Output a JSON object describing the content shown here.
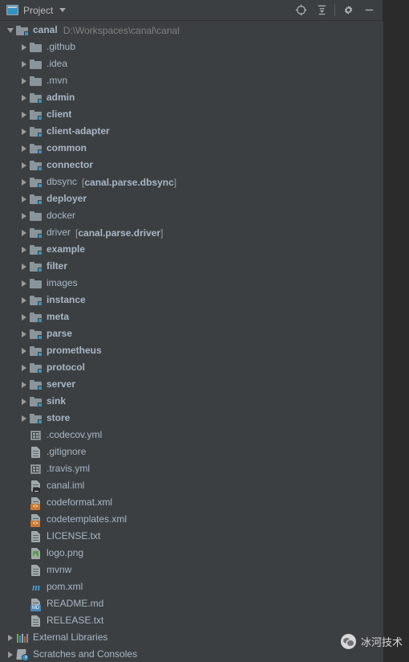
{
  "header": {
    "title": "Project",
    "icon": "project-window-icon",
    "dropdown_icon": "chevron-down-icon",
    "buttons": [
      {
        "name": "select-opened-file-button",
        "icon": "crosshair-target-icon",
        "label": ""
      },
      {
        "name": "collapse-all-button",
        "icon": "collapse-all-icon",
        "label": ""
      },
      {
        "name": "settings-button",
        "icon": "gear-icon",
        "label": ""
      },
      {
        "name": "hide-button",
        "icon": "minimize-dash-icon",
        "label": ""
      }
    ]
  },
  "tree": {
    "root": {
      "label": "canal",
      "path": "D:\\Workspaces\\canal\\canal",
      "icon": "module-folder-icon",
      "expanded": true
    },
    "items": [
      {
        "label": ".github",
        "icon": "folder-icon",
        "kind": "folder",
        "indent": 1,
        "expandable": true,
        "bold": false,
        "module": ""
      },
      {
        "label": ".idea",
        "icon": "folder-icon",
        "kind": "folder",
        "indent": 1,
        "expandable": true,
        "bold": false,
        "module": ""
      },
      {
        "label": ".mvn",
        "icon": "folder-icon",
        "kind": "folder",
        "indent": 1,
        "expandable": true,
        "bold": false,
        "module": ""
      },
      {
        "label": "admin",
        "icon": "module-folder-icon",
        "kind": "module",
        "indent": 1,
        "expandable": true,
        "bold": true,
        "module": ""
      },
      {
        "label": "client",
        "icon": "module-folder-icon",
        "kind": "module",
        "indent": 1,
        "expandable": true,
        "bold": true,
        "module": ""
      },
      {
        "label": "client-adapter",
        "icon": "module-folder-icon",
        "kind": "module",
        "indent": 1,
        "expandable": true,
        "bold": true,
        "module": ""
      },
      {
        "label": "common",
        "icon": "module-folder-icon",
        "kind": "module",
        "indent": 1,
        "expandable": true,
        "bold": true,
        "module": ""
      },
      {
        "label": "connector",
        "icon": "module-folder-icon",
        "kind": "module",
        "indent": 1,
        "expandable": true,
        "bold": true,
        "module": ""
      },
      {
        "label": "dbsync",
        "icon": "module-folder-icon",
        "kind": "module",
        "indent": 1,
        "expandable": true,
        "bold": false,
        "module": "canal.parse.dbsync"
      },
      {
        "label": "deployer",
        "icon": "module-folder-icon",
        "kind": "module",
        "indent": 1,
        "expandable": true,
        "bold": true,
        "module": ""
      },
      {
        "label": "docker",
        "icon": "folder-icon",
        "kind": "folder",
        "indent": 1,
        "expandable": true,
        "bold": false,
        "module": ""
      },
      {
        "label": "driver",
        "icon": "module-folder-icon",
        "kind": "module",
        "indent": 1,
        "expandable": true,
        "bold": false,
        "module": "canal.parse.driver"
      },
      {
        "label": "example",
        "icon": "module-folder-icon",
        "kind": "module",
        "indent": 1,
        "expandable": true,
        "bold": true,
        "module": ""
      },
      {
        "label": "filter",
        "icon": "module-folder-icon",
        "kind": "module",
        "indent": 1,
        "expandable": true,
        "bold": true,
        "module": ""
      },
      {
        "label": "images",
        "icon": "folder-icon",
        "kind": "folder",
        "indent": 1,
        "expandable": true,
        "bold": false,
        "module": ""
      },
      {
        "label": "instance",
        "icon": "module-folder-icon",
        "kind": "module",
        "indent": 1,
        "expandable": true,
        "bold": true,
        "module": ""
      },
      {
        "label": "meta",
        "icon": "module-folder-icon",
        "kind": "module",
        "indent": 1,
        "expandable": true,
        "bold": true,
        "module": ""
      },
      {
        "label": "parse",
        "icon": "module-folder-icon",
        "kind": "module",
        "indent": 1,
        "expandable": true,
        "bold": true,
        "module": ""
      },
      {
        "label": "prometheus",
        "icon": "module-folder-icon",
        "kind": "module",
        "indent": 1,
        "expandable": true,
        "bold": true,
        "module": ""
      },
      {
        "label": "protocol",
        "icon": "module-folder-icon",
        "kind": "module",
        "indent": 1,
        "expandable": true,
        "bold": true,
        "module": ""
      },
      {
        "label": "server",
        "icon": "module-folder-icon",
        "kind": "module",
        "indent": 1,
        "expandable": true,
        "bold": true,
        "module": ""
      },
      {
        "label": "sink",
        "icon": "module-folder-icon",
        "kind": "module",
        "indent": 1,
        "expandable": true,
        "bold": true,
        "module": ""
      },
      {
        "label": "store",
        "icon": "module-folder-icon",
        "kind": "module",
        "indent": 1,
        "expandable": true,
        "bold": true,
        "module": ""
      },
      {
        "label": ".codecov.yml",
        "icon": "yaml-file-icon",
        "kind": "yml",
        "indent": 1,
        "expandable": false,
        "bold": false,
        "module": ""
      },
      {
        "label": ".gitignore",
        "icon": "text-file-icon",
        "kind": "file",
        "indent": 1,
        "expandable": false,
        "bold": false,
        "module": ""
      },
      {
        "label": ".travis.yml",
        "icon": "yaml-file-icon",
        "kind": "yml",
        "indent": 1,
        "expandable": false,
        "bold": false,
        "module": ""
      },
      {
        "label": "canal.iml",
        "icon": "iml-file-icon",
        "kind": "iml",
        "indent": 1,
        "expandable": false,
        "bold": false,
        "module": ""
      },
      {
        "label": "codeformat.xml",
        "icon": "xml-file-icon",
        "kind": "xml",
        "indent": 1,
        "expandable": false,
        "bold": false,
        "module": ""
      },
      {
        "label": "codetemplates.xml",
        "icon": "xml-file-icon",
        "kind": "xml",
        "indent": 1,
        "expandable": false,
        "bold": false,
        "module": ""
      },
      {
        "label": "LICENSE.txt",
        "icon": "text-file-icon",
        "kind": "file",
        "indent": 1,
        "expandable": false,
        "bold": false,
        "module": ""
      },
      {
        "label": "logo.png",
        "icon": "image-file-icon",
        "kind": "png",
        "indent": 1,
        "expandable": false,
        "bold": false,
        "module": ""
      },
      {
        "label": "mvnw",
        "icon": "text-file-icon",
        "kind": "file",
        "indent": 1,
        "expandable": false,
        "bold": false,
        "module": ""
      },
      {
        "label": "pom.xml",
        "icon": "maven-pom-icon",
        "kind": "maven",
        "indent": 1,
        "expandable": false,
        "bold": false,
        "module": ""
      },
      {
        "label": "README.md",
        "icon": "markdown-file-icon",
        "kind": "md",
        "indent": 1,
        "expandable": false,
        "bold": false,
        "module": ""
      },
      {
        "label": "RELEASE.txt",
        "icon": "text-file-icon",
        "kind": "file",
        "indent": 1,
        "expandable": false,
        "bold": false,
        "module": ""
      },
      {
        "label": "External Libraries",
        "icon": "libraries-icon",
        "kind": "libs",
        "indent": 0,
        "expandable": true,
        "bold": false,
        "module": ""
      },
      {
        "label": "Scratches and Consoles",
        "icon": "scratches-icon",
        "kind": "scratch",
        "indent": 0,
        "expandable": true,
        "bold": false,
        "module": ""
      }
    ]
  },
  "watermark": {
    "text": "冰河技术",
    "icon": "wechat-icon"
  },
  "colors": {
    "panel_background": "#3c3f41",
    "editor_background": "#2b2b2b",
    "header_background": "#3c3f41",
    "text": "#a9b7c6",
    "secondary_text": "#808080",
    "accent_blue": "#3592c4",
    "xml_badge": "#cc7832",
    "md_badge": "#4a87b8"
  }
}
